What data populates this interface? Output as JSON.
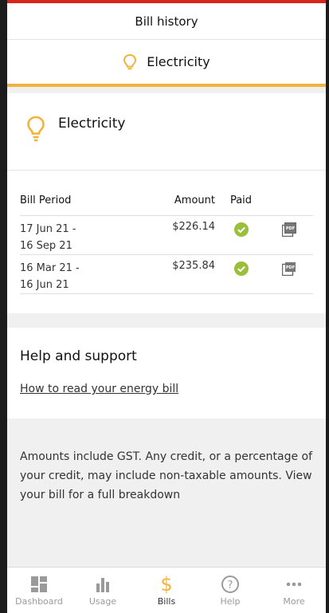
{
  "header": {
    "title": "Bill history"
  },
  "tab": {
    "label": "Electricity",
    "icon": "lightbulb-icon"
  },
  "account": {
    "title": "Electricity",
    "icon": "lightbulb-icon"
  },
  "table": {
    "columns": {
      "period": "Bill Period",
      "amount": "Amount",
      "paid": "Paid"
    },
    "rows": [
      {
        "period_start": "17 Jun 21 -",
        "period_end": "16 Sep 21",
        "amount": "$226.14",
        "paid": true,
        "pdf_icon": "pdf-icon"
      },
      {
        "period_start": "16 Mar 21 -",
        "period_end": "16 Jun 21",
        "amount": "$235.84",
        "paid": true,
        "pdf_icon": "pdf-icon"
      }
    ]
  },
  "help": {
    "title": "Help and support",
    "link": "How to read your energy bill"
  },
  "note": "Amounts include GST. Any credit, or a percentage of your credit, may include non-taxable amounts. View your bill for a full breakdown",
  "nav": {
    "items": [
      {
        "label": "Dashboard",
        "icon": "dashboard-icon"
      },
      {
        "label": "Usage",
        "icon": "bar-chart-icon"
      },
      {
        "label": "Bills",
        "icon": "dollar-icon",
        "active": true
      },
      {
        "label": "Help",
        "icon": "question-circle-icon"
      },
      {
        "label": "More",
        "icon": "more-dots-icon"
      }
    ]
  },
  "colors": {
    "accent": "#f2b33d",
    "brand_red": "#d8261b",
    "paid_green": "#9bbf3a"
  }
}
